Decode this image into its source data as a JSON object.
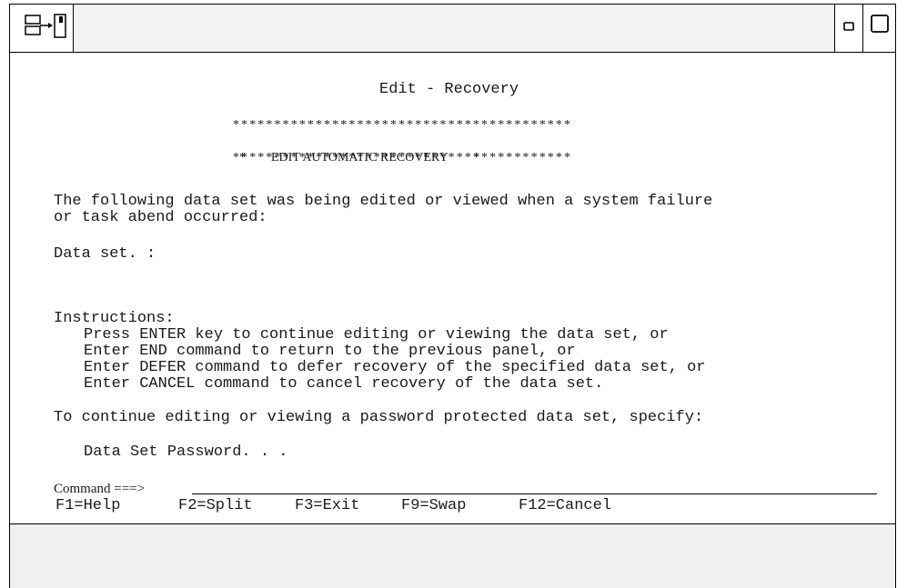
{
  "panel": {
    "title": "Edit - Recovery",
    "banner_stars_top": "*****************************************",
    "banner_line": "*        EDIT AUTOMATIC RECOVERY        *",
    "banner_stars_bottom": "*****************************************"
  },
  "message": {
    "line1": "The following data set was being edited or viewed when a system failure",
    "line2": "or task abend occurred:"
  },
  "dataset_label": "Data set. :",
  "instructions": {
    "heading": "Instructions:",
    "items": [
      "Press ENTER key to continue editing or viewing the data set, or",
      "Enter END command to return to the previous panel, or",
      "Enter DEFER command to defer recovery of the specified data set, or",
      "Enter CANCEL command to cancel recovery of the data set."
    ]
  },
  "password_prompt": "To continue editing or viewing a password protected data set, specify:",
  "password_label": "Data Set Password. . .",
  "command": {
    "label": "Command ===>",
    "value": ""
  },
  "function_keys": [
    {
      "label": "F1=Help"
    },
    {
      "label": "F2=Split"
    },
    {
      "label": "F3=Exit"
    },
    {
      "label": "F9=Swap"
    },
    {
      "label": "F12=Cancel"
    }
  ],
  "icons": {
    "app": "split-window-icon",
    "minimize": "minimize-icon",
    "maximize": "maximize-icon"
  }
}
